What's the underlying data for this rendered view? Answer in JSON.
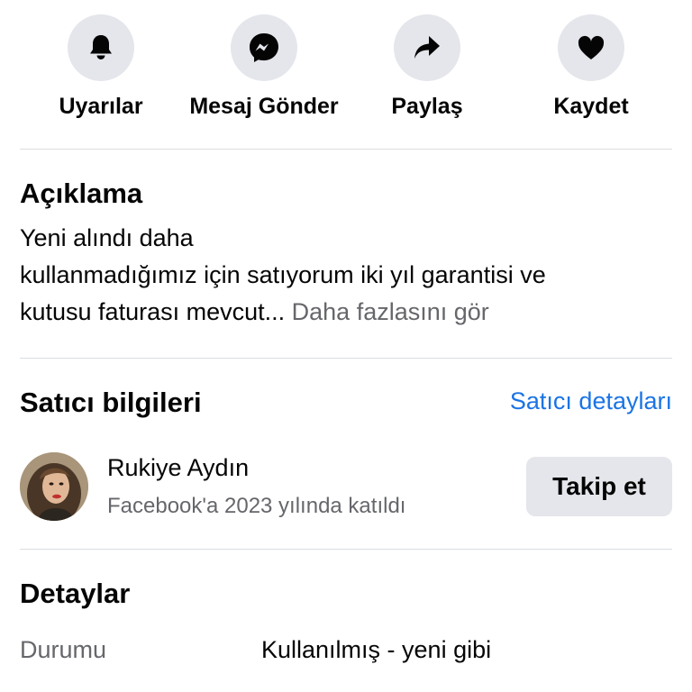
{
  "actions": [
    {
      "label": "Uyarılar",
      "icon": "bell-icon"
    },
    {
      "label": "Mesaj Gönder",
      "icon": "messenger-icon"
    },
    {
      "label": "Paylaş",
      "icon": "share-icon"
    },
    {
      "label": "Kaydet",
      "icon": "heart-icon"
    }
  ],
  "description": {
    "title": "Açıklama",
    "text": "Yeni alındı daha kullanmadığımız için satıyorum iki yıl garantisi ve kutusu faturası mevcut...",
    "line1": "Yeni alındı daha",
    "line2": "kullanmadığımız için satıyorum iki yıl garantisi ve",
    "line3": "kutusu faturası mevcut...",
    "more_label": "Daha fazlasını gör"
  },
  "seller": {
    "title": "Satıcı bilgileri",
    "details_link": "Satıcı detayları",
    "name": "Rukiye Aydın",
    "joined": "Facebook'a 2023 yılında katıldı",
    "follow_label": "Takip et"
  },
  "details": {
    "title": "Detaylar",
    "rows": [
      {
        "key": "Durumu",
        "value": "Kullanılmış - yeni gibi"
      }
    ]
  },
  "colors": {
    "link": "#1b74e4",
    "secondary_text": "#65676b",
    "button_bg": "#e4e6eb",
    "divider": "#dadde1"
  }
}
